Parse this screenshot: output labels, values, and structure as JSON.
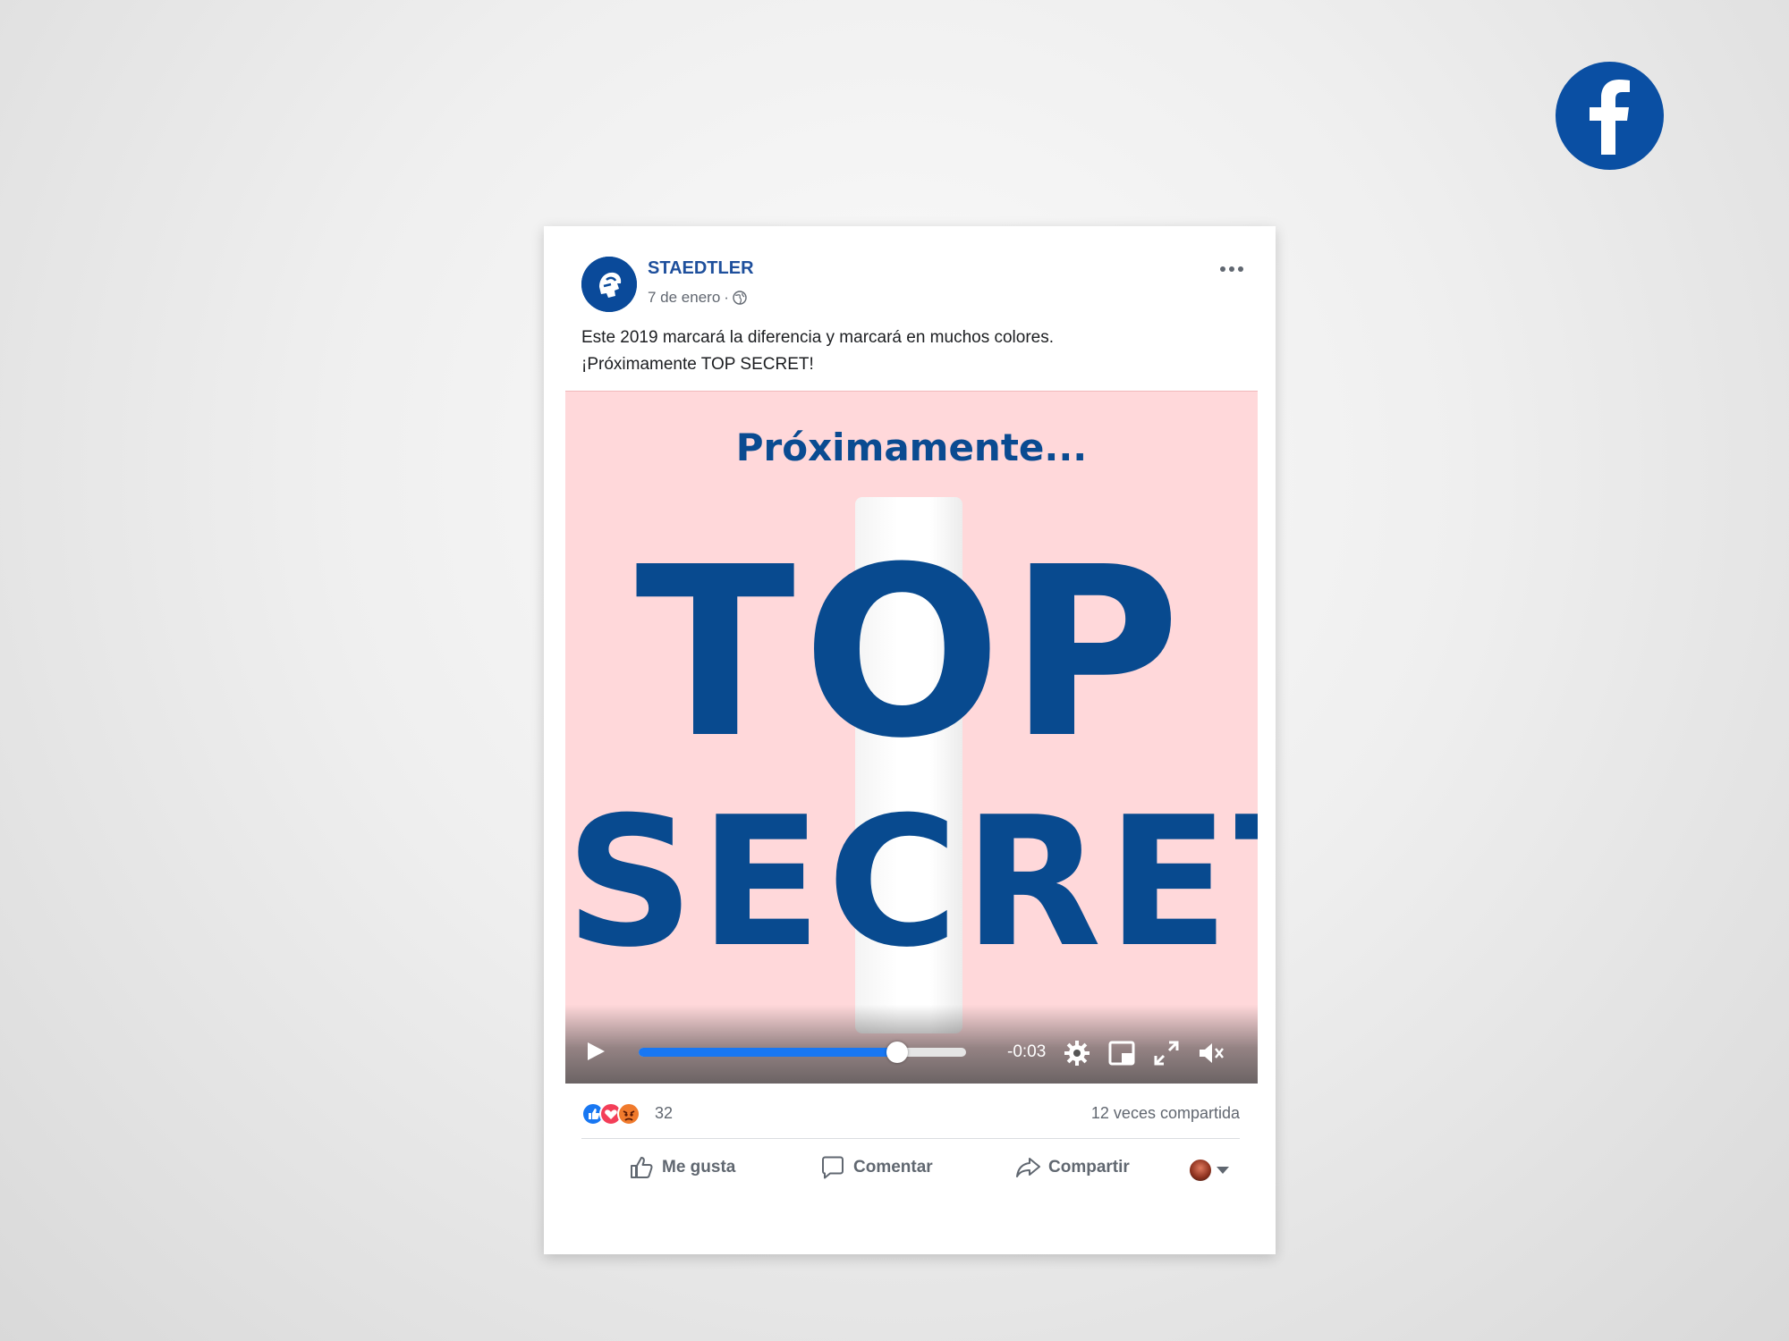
{
  "colors": {
    "brand_blue": "#1e4f9c",
    "facebook_blue": "#0a4fa3",
    "media_background": "#ffd8da",
    "headline_blue": "#084a8f",
    "progress_blue": "#1877f2"
  },
  "badge": {
    "icon": "facebook-logo-icon"
  },
  "post": {
    "page_name": "STAEDTLER",
    "date": "7 de enero",
    "separator": "·",
    "privacy_icon": "globe-icon",
    "menu_icon": "more-options-icon",
    "text_line1": "Este 2019 marcará la diferencia y marcará en muchos colores.",
    "text_line2": "¡Próximamente TOP SECRET!"
  },
  "media": {
    "subtitle": "Próximamente...",
    "headline_line1": "TOP",
    "headline_line2": "SECRET"
  },
  "player": {
    "progress": 0.79,
    "time_remaining": "-0:03",
    "controls": [
      "play-icon",
      "settings-icon",
      "picture-in-picture-icon",
      "fullscreen-icon",
      "mute-icon"
    ]
  },
  "engagement": {
    "reaction_icons": [
      "like-reaction-icon",
      "love-reaction-icon",
      "angry-reaction-icon"
    ],
    "reaction_count": "32",
    "shares": "12 veces compartida"
  },
  "actions": {
    "like": "Me gusta",
    "comment": "Comentar",
    "share": "Compartir"
  }
}
